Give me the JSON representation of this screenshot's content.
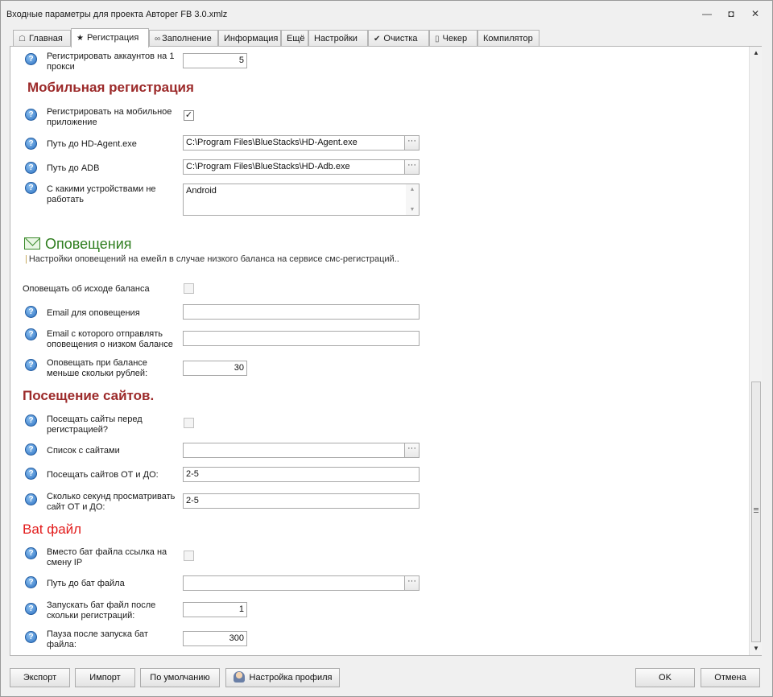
{
  "window": {
    "title": "Входные параметры для проекта Авторег FB 3.0.xmlz",
    "minimize": "—",
    "restore": "◘",
    "close": "✕"
  },
  "tabs": [
    {
      "label": "Главная",
      "icon": "home-icon",
      "glyph": "☖"
    },
    {
      "label": "Регистрация",
      "icon": "star-icon",
      "glyph": "★"
    },
    {
      "label": "Заполнение",
      "icon": "infinity-icon",
      "glyph": "∞"
    },
    {
      "label": "Информация",
      "icon": "",
      "glyph": ""
    },
    {
      "label": "Ещё",
      "icon": "",
      "glyph": ""
    },
    {
      "label": "Настройки",
      "icon": "",
      "glyph": ""
    },
    {
      "label": "Очистка",
      "icon": "checkmark-icon",
      "glyph": "✔"
    },
    {
      "label": "Чекер",
      "icon": "phone-icon",
      "glyph": "▯"
    },
    {
      "label": "Компилятор",
      "icon": "",
      "glyph": ""
    }
  ],
  "active_tab": "Регистрация",
  "help_glyph": "?",
  "check_glyph": "✓",
  "proxy": {
    "accounts_label": "Регистрировать аккаунтов на 1 прокси",
    "accounts_value": "5"
  },
  "mobile": {
    "title": "Мобильная регистрация",
    "register_label": "Регистрировать на мобильное приложение",
    "register_checked": true,
    "hd_agent_label": "Путь до HD-Agent.exe",
    "hd_agent_value": "C:\\Program Files\\BlueStacks\\HD-Agent.exe",
    "adb_label": "Путь до ADB",
    "adb_value": "C:\\Program Files\\BlueStacks\\HD-Adb.exe",
    "devices_label": "С какими устройствами не работать",
    "devices_value": "Android"
  },
  "notifications": {
    "title": "Оповещения",
    "description": "Настройки оповещений на емейл в случае низкого баланса на сервисе смс-регистраций..",
    "balance_label": "Оповещать об  исходе баланса",
    "balance_checked": false,
    "email_label": "Email для оповещения",
    "email_value": "",
    "from_email_label": "Email с которого отправлять оповещения о низком балансе",
    "from_email_value": "",
    "threshold_label": "Оповещать при балансе меньше скольки рублей:",
    "threshold_value": "30"
  },
  "visits": {
    "title": "Посещение сайтов.",
    "before_label": "Посещать сайты перед регистрацией?",
    "before_checked": false,
    "list_label": "Список с сайтами",
    "list_value": "",
    "range_label": "Посещать сайтов ОТ и ДО:",
    "range_value": "2-5",
    "seconds_label": "Сколько секунд просматривать сайт ОТ и ДО:",
    "seconds_value": "2-5"
  },
  "bat": {
    "title": "Bat файл",
    "link_label": "Вместо бат файла ссылка на смену IP",
    "link_checked": false,
    "path_label": "Путь до бат файла",
    "path_value": "",
    "after_label": "Запускать бат файл после скольки регистраций:",
    "after_value": "1",
    "pause_label": "Пауза после запуска бат файла:",
    "pause_value": "300"
  },
  "ellipsis": "···",
  "footer": {
    "export": "Экспорт",
    "import": "Импорт",
    "defaults": "По умолчанию",
    "profile": "Настройка профиля",
    "ok": "OK",
    "cancel": "Отмена"
  },
  "colors": {
    "section_dark": "#9c2a2a",
    "section_red": "#e21b1b",
    "section_green": "#2e7d1e",
    "help_blue": "#2a6fc0"
  }
}
